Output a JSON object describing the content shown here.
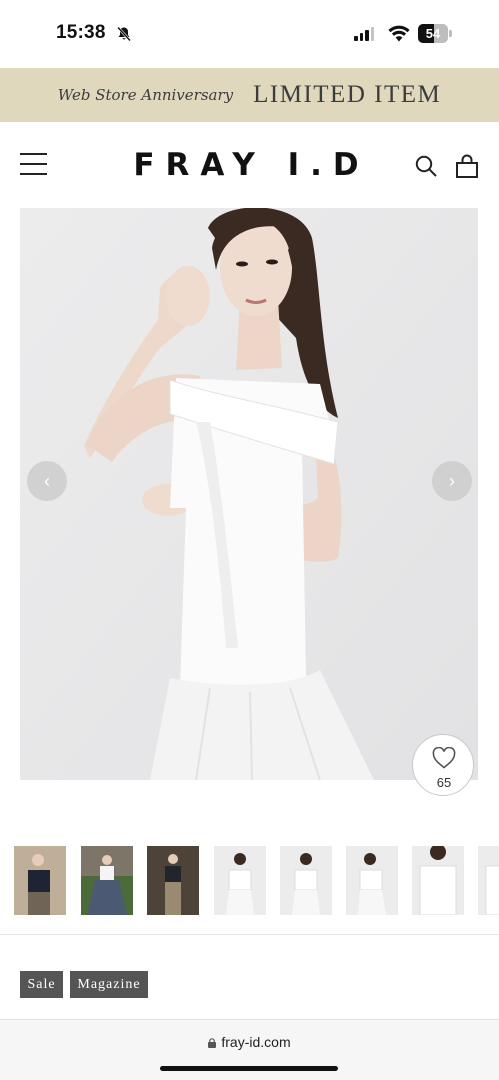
{
  "status_bar": {
    "time": "15:38",
    "battery_level": "54",
    "icons": [
      "bell-slash-icon",
      "signal-icon",
      "wifi-icon",
      "battery-icon"
    ]
  },
  "promo_banner": {
    "subtitle": "Web Store Anniversary",
    "title": "LIMITED ITEM",
    "background": "#dfd8bd"
  },
  "header": {
    "logo": "FRAY I.D",
    "icons": [
      "hamburger-menu-icon",
      "search-icon",
      "shopping-bag-icon"
    ]
  },
  "product_gallery": {
    "main_image": "model in white off-shoulder top",
    "favorite_count": "65",
    "thumbnail_count": 8,
    "arrows": [
      "chevron-left-icon",
      "chevron-right-icon"
    ]
  },
  "tags": {
    "sale": "Sale",
    "magazine": "Magazine"
  },
  "browser": {
    "url": "fray-id.com"
  }
}
